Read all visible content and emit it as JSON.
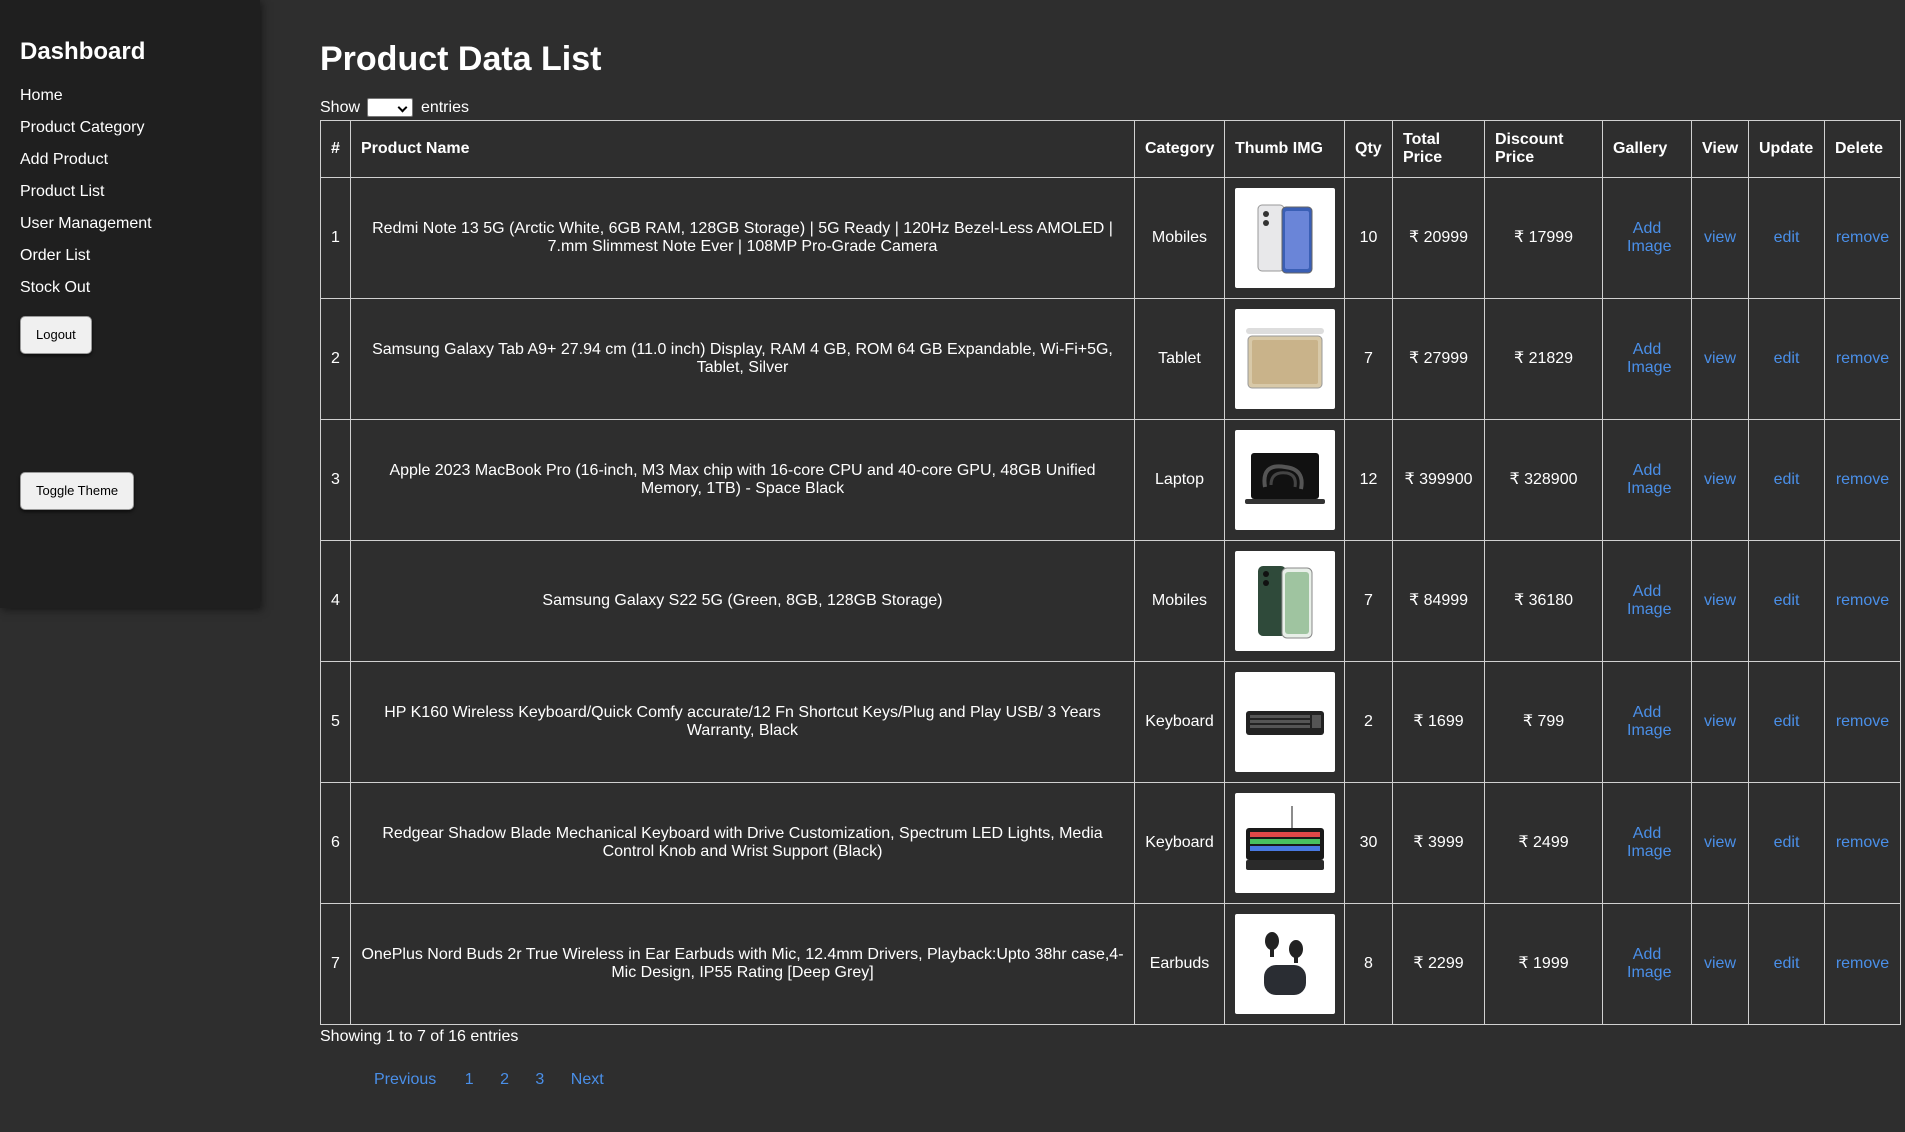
{
  "sidebar": {
    "title": "Dashboard",
    "items": [
      {
        "label": "Home"
      },
      {
        "label": "Product Category"
      },
      {
        "label": "Add Product"
      },
      {
        "label": "Product List"
      },
      {
        "label": "User Management"
      },
      {
        "label": "Order List"
      },
      {
        "label": "Stock Out"
      }
    ],
    "logout_label": "Logout",
    "toggle_theme_label": "Toggle Theme"
  },
  "main": {
    "title": "Product Data List",
    "show_label": "Show",
    "entries_label": "entries",
    "selected_entries": ""
  },
  "table": {
    "headers": {
      "num": "#",
      "name": "Product Name",
      "category": "Category",
      "thumb": "Thumb IMG",
      "qty": "Qty",
      "total": "Total Price",
      "discount": "Discount Price",
      "gallery": "Gallery",
      "view": "View",
      "update": "Update",
      "delete": "Delete"
    },
    "rows": [
      {
        "num": "1",
        "name": "Redmi Note 13 5G (Arctic White, 6GB RAM, 128GB Storage) | 5G Ready | 120Hz Bezel-Less AMOLED | 7.mm Slimmest Note Ever | 108MP Pro-Grade Camera",
        "category": "Mobiles",
        "thumb_icon": "phone-white-image",
        "qty": "10",
        "total": "₹ 20999",
        "discount": "₹ 17999",
        "gallery": "Add Image",
        "view": "view",
        "update": "edit",
        "delete": "remove"
      },
      {
        "num": "2",
        "name": "Samsung Galaxy Tab A9+ 27.94 cm (11.0 inch) Display, RAM 4 GB, ROM 64 GB Expandable, Wi-Fi+5G, Tablet, Silver",
        "category": "Tablet",
        "thumb_icon": "tablet-image",
        "qty": "7",
        "total": "₹ 27999",
        "discount": "₹ 21829",
        "gallery": "Add Image",
        "view": "view",
        "update": "edit",
        "delete": "remove"
      },
      {
        "num": "3",
        "name": "Apple 2023 MacBook Pro (16-inch, M3 Max chip with 16-core CPU and 40-core GPU, 48GB Unified Memory, 1TB) - Space Black",
        "category": "Laptop",
        "thumb_icon": "laptop-image",
        "qty": "12",
        "total": "₹ 399900",
        "discount": "₹ 328900",
        "gallery": "Add Image",
        "view": "view",
        "update": "edit",
        "delete": "remove"
      },
      {
        "num": "4",
        "name": "Samsung Galaxy S22 5G (Green, 8GB, 128GB Storage)",
        "category": "Mobiles",
        "thumb_icon": "phone-green-image",
        "qty": "7",
        "total": "₹ 84999",
        "discount": "₹ 36180",
        "gallery": "Add Image",
        "view": "view",
        "update": "edit",
        "delete": "remove"
      },
      {
        "num": "5",
        "name": "HP K160 Wireless Keyboard/Quick Comfy accurate/12 Fn Shortcut Keys/Plug and Play USB/ 3 Years Warranty, Black",
        "category": "Keyboard",
        "thumb_icon": "keyboard-image",
        "qty": "2",
        "total": "₹ 1699",
        "discount": "₹ 799",
        "gallery": "Add Image",
        "view": "view",
        "update": "edit",
        "delete": "remove"
      },
      {
        "num": "6",
        "name": "Redgear Shadow Blade Mechanical Keyboard with Drive Customization, Spectrum LED Lights, Media Control Knob and Wrist Support (Black)",
        "category": "Keyboard",
        "thumb_icon": "rgb-keyboard-image",
        "qty": "30",
        "total": "₹ 3999",
        "discount": "₹ 2499",
        "gallery": "Add Image",
        "view": "view",
        "update": "edit",
        "delete": "remove"
      },
      {
        "num": "7",
        "name": "OnePlus Nord Buds 2r True Wireless in Ear Earbuds with Mic, 12.4mm Drivers, Playback:Upto 38hr case,4-Mic Design, IP55 Rating [Deep Grey]",
        "category": "Earbuds",
        "thumb_icon": "earbuds-image",
        "qty": "8",
        "total": "₹ 2299",
        "discount": "₹ 1999",
        "gallery": "Add Image",
        "view": "view",
        "update": "edit",
        "delete": "remove"
      }
    ]
  },
  "footer": {
    "showing": "Showing 1 to 7 of 16 entries",
    "pagination": {
      "previous": "Previous",
      "pages": [
        "1",
        "2",
        "3"
      ],
      "next": "Next"
    }
  },
  "colors": {
    "background": "#2e2e2e",
    "sidebar": "#1f1f1f",
    "link": "#4a8fe8",
    "text": "#ffffff"
  }
}
